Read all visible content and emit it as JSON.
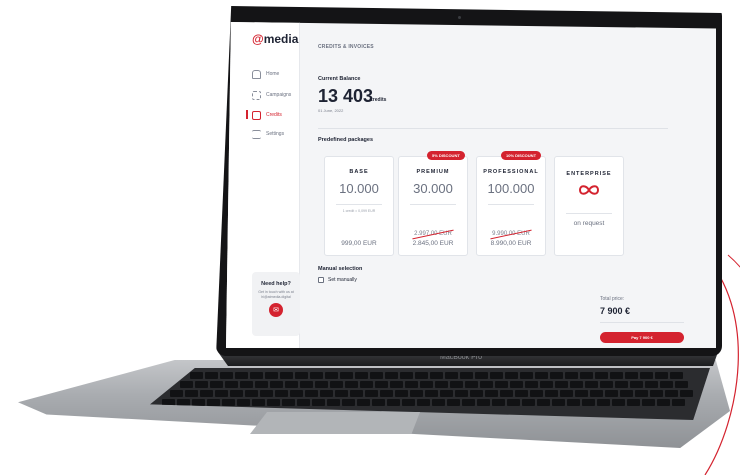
{
  "device": {
    "label": "MacBook Pro"
  },
  "brand": {
    "logo_symbol": "@",
    "logo_text": "media",
    "accent": "#d4232f"
  },
  "sidebar": {
    "items": [
      {
        "label": "Home",
        "icon": "home-icon",
        "active": false
      },
      {
        "label": "Campaigns",
        "icon": "grid-icon",
        "active": false
      },
      {
        "label": "Credits",
        "icon": "wallet-icon",
        "active": true
      },
      {
        "label": "Settings",
        "icon": "sliders-icon",
        "active": false
      }
    ],
    "help": {
      "title": "Need help?",
      "text": "Get in touch with us at hi@atmedia.digital",
      "button_icon": "mail-icon"
    }
  },
  "main": {
    "section_title": "CREDITS & INVOICES",
    "balance": {
      "label": "Current Balance",
      "value": "13 403",
      "unit": "credits",
      "date": "01 June, 2022"
    },
    "packages_label": "Predefined packages",
    "packages": [
      {
        "name": "BASE",
        "credits": "10.000",
        "note": "1 credit = 0,099 EUR",
        "old_price": "",
        "price": "999,00 EUR",
        "badge": ""
      },
      {
        "name": "PREMIUM",
        "credits": "30.000",
        "note": "",
        "old_price": "2.997,00 EUR",
        "price": "2.845,00 EUR",
        "badge": "5% DISCOUNT"
      },
      {
        "name": "PROFESSIONAL",
        "credits": "100.000",
        "note": "",
        "old_price": "9.990,00 EUR",
        "price": "8.990,00 EUR",
        "badge": "10% DISCOUNT"
      },
      {
        "name": "ENTERPRISE",
        "credits": "",
        "icon": "infinity-icon",
        "note": "",
        "old_price": "",
        "price": "on request",
        "badge": ""
      }
    ],
    "manual": {
      "label": "Manual selection",
      "checkbox_label": "Set manually",
      "checked": false
    },
    "total": {
      "label": "Total price:",
      "value": "7 900 €",
      "pay_label": "Pay 7 900 €"
    }
  }
}
